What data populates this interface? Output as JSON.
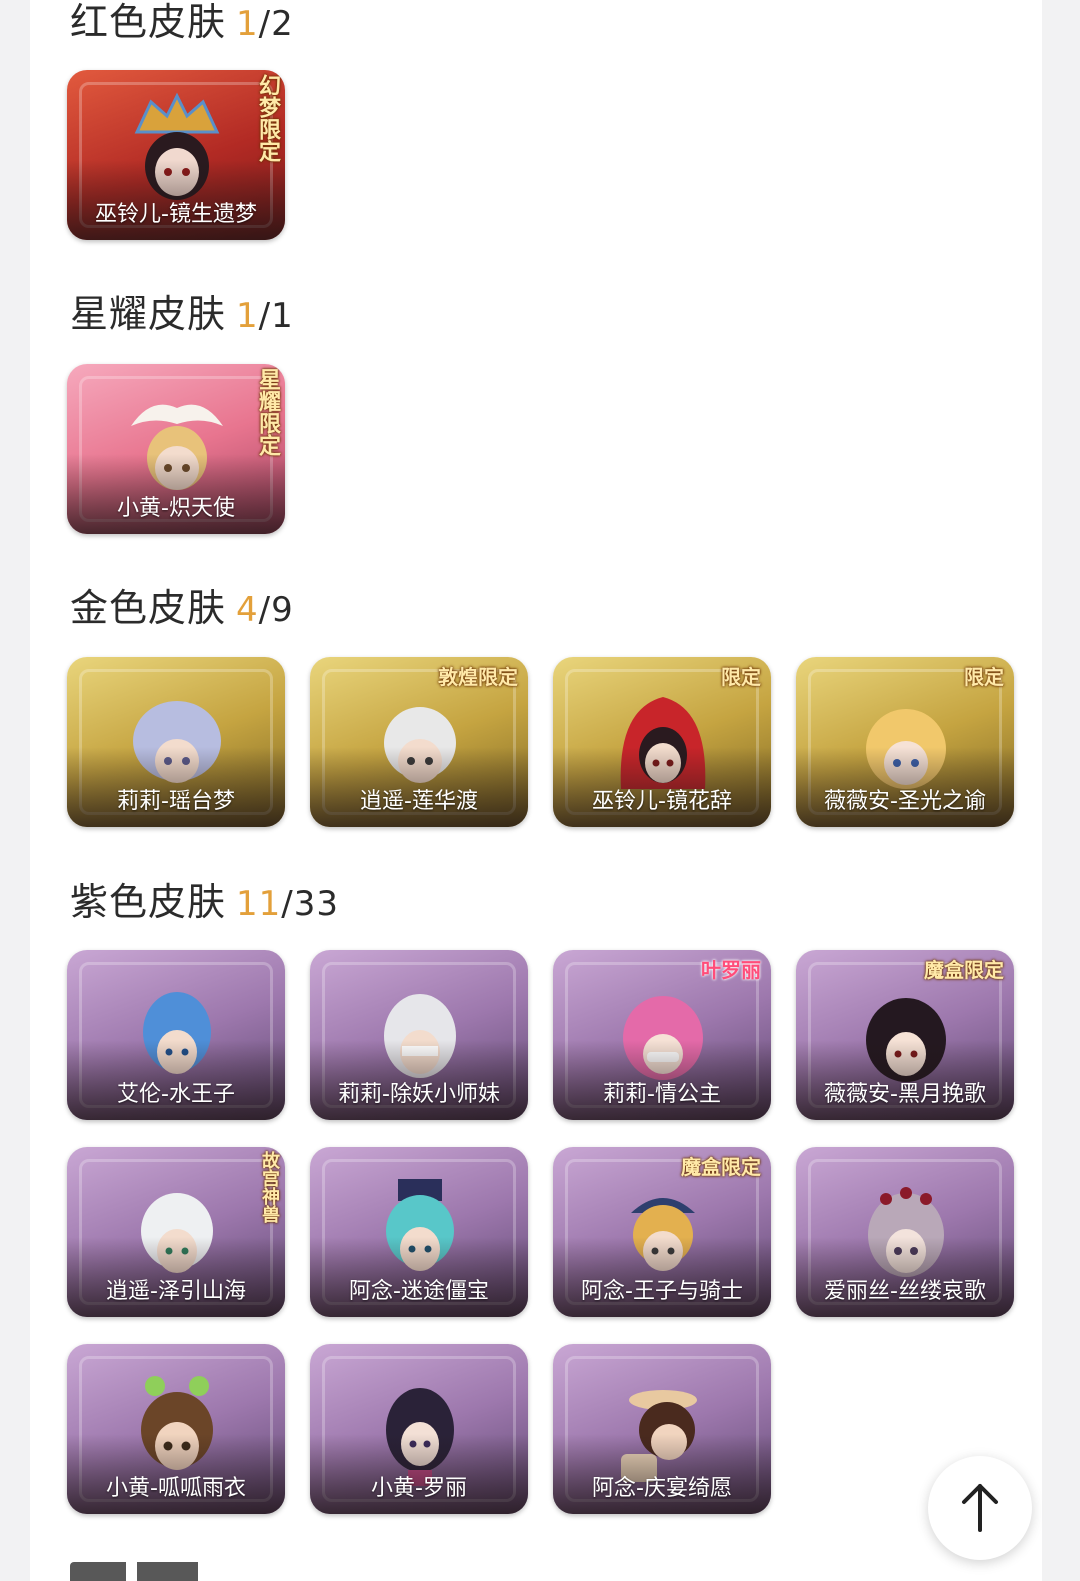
{
  "sections": [
    {
      "title": "红色皮肤",
      "owned": "1",
      "total": "/2"
    },
    {
      "title": "星耀皮肤",
      "owned": "1",
      "total": "/1"
    },
    {
      "title": "金色皮肤",
      "owned": "4",
      "total": "/9"
    },
    {
      "title": "紫色皮肤",
      "owned": "11",
      "total": "/33"
    }
  ],
  "red_skins": [
    {
      "name": "巫铃儿-镜生遗梦",
      "badge": "幻梦限定"
    }
  ],
  "star_skins": [
    {
      "name": "小黄-炽天使",
      "badge": "星耀限定"
    }
  ],
  "gold_skins": [
    {
      "name": "莉莉-瑶台梦",
      "badge": ""
    },
    {
      "name": "逍遥-莲华渡",
      "badge": "敦煌限定"
    },
    {
      "name": "巫铃儿-镜花辞",
      "badge": "限定"
    },
    {
      "name": "薇薇安-圣光之谕",
      "badge": "限定"
    }
  ],
  "purple_skins": [
    {
      "name": "艾伦-水王子",
      "badge": ""
    },
    {
      "name": "莉莉-除妖小师妹",
      "badge": ""
    },
    {
      "name": "莉莉-情公主",
      "badge": "叶罗丽"
    },
    {
      "name": "薇薇安-黑月挽歌",
      "badge": "魔盒限定"
    },
    {
      "name": "逍遥-泽引山海",
      "badge": "故宫神兽"
    },
    {
      "name": "阿念-迷途僵宝",
      "badge": ""
    },
    {
      "name": "阿念-王子与骑士",
      "badge": "魔盒限定"
    },
    {
      "name": "爱丽丝-丝缕哀歌",
      "badge": ""
    },
    {
      "name": "小黄-呱呱雨衣",
      "badge": ""
    },
    {
      "name": "小黄-罗丽",
      "badge": ""
    },
    {
      "name": "阿念-庆宴绮愿",
      "badge": ""
    }
  ],
  "colors": {
    "accent_count": "#e3a03a",
    "title_text": "#2b2b2b"
  },
  "icons": {
    "scroll_top": "arrow-up-icon"
  }
}
